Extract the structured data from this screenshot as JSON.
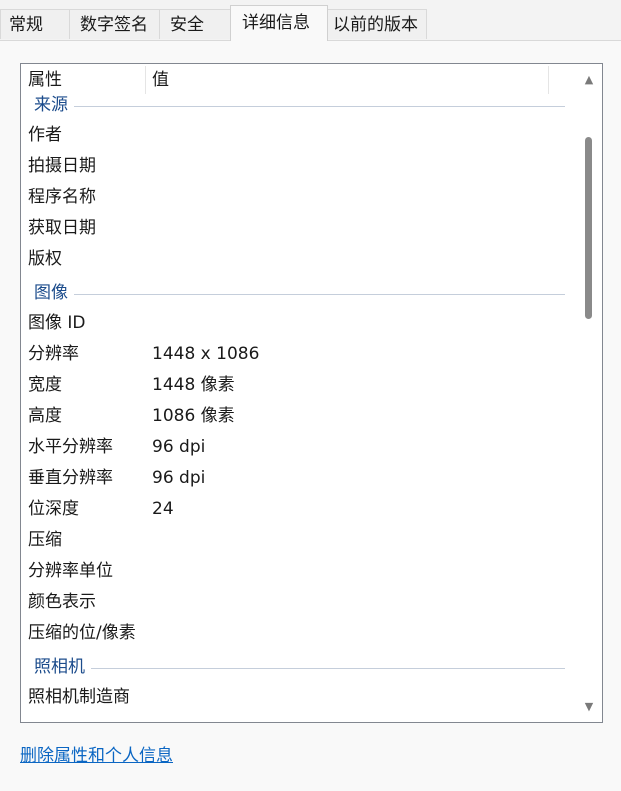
{
  "tabs": [
    {
      "label": "常规"
    },
    {
      "label": "数字签名"
    },
    {
      "label": "安全"
    },
    {
      "label": "详细信息"
    },
    {
      "label": "以前的版本"
    }
  ],
  "columns": {
    "property": "属性",
    "value": "值"
  },
  "groups": {
    "source": {
      "title": "来源",
      "rows": [
        {
          "prop": "作者",
          "val": ""
        },
        {
          "prop": "拍摄日期",
          "val": ""
        },
        {
          "prop": "程序名称",
          "val": ""
        },
        {
          "prop": "获取日期",
          "val": ""
        },
        {
          "prop": "版权",
          "val": ""
        }
      ]
    },
    "image": {
      "title": "图像",
      "rows": [
        {
          "prop": "图像 ID",
          "val": ""
        },
        {
          "prop": "分辨率",
          "val": "1448 x 1086"
        },
        {
          "prop": "宽度",
          "val": "1448 像素"
        },
        {
          "prop": "高度",
          "val": "1086 像素"
        },
        {
          "prop": "水平分辨率",
          "val": "96 dpi"
        },
        {
          "prop": "垂直分辨率",
          "val": "96 dpi"
        },
        {
          "prop": "位深度",
          "val": "24"
        },
        {
          "prop": "压缩",
          "val": ""
        },
        {
          "prop": "分辨率单位",
          "val": ""
        },
        {
          "prop": "颜色表示",
          "val": ""
        },
        {
          "prop": "压缩的位/像素",
          "val": ""
        }
      ]
    },
    "camera": {
      "title": "照相机",
      "rows": [
        {
          "prop": "照相机制造商",
          "val": ""
        }
      ]
    }
  },
  "scrollbar": {
    "up_icon": "triangle-up-icon",
    "down_icon": "triangle-down-icon"
  },
  "link": {
    "label": "删除属性和个人信息"
  }
}
